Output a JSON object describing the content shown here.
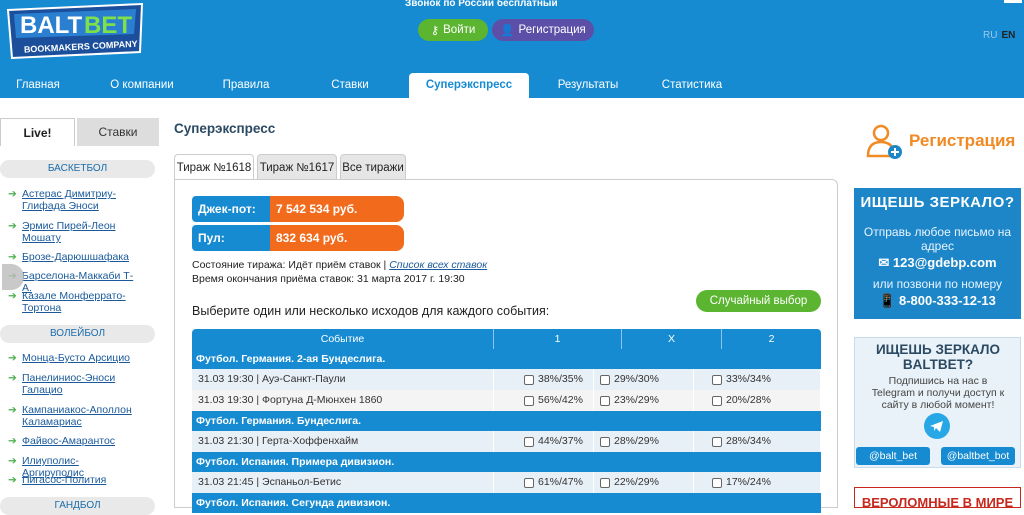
{
  "header": {
    "logo_text_1": "BALT",
    "logo_text_2": "BET",
    "logo_subtitle": "BOOKMAKERS COMPANY",
    "phone_text": "Звонок по России бесплатный",
    "login_label": "Войти",
    "register_label": "Регистрация",
    "lang_ru": "RU",
    "lang_en": "EN"
  },
  "nav": [
    "Главная",
    "О компании",
    "Правила",
    "Ставки",
    "Суперэкспресс",
    "Результаты",
    "Статистика"
  ],
  "sidebar": {
    "tab_live": "Live!",
    "tab_bets": "Ставки",
    "sections": [
      {
        "title": "БАСКЕТБОЛ",
        "events": [
          "Астерас Димитриу-Глифада Эноси",
          "Эрмис Пирей-Леон Мошату",
          "Брозе-Дарюшшафака",
          "Барселона-Маккаби Т-А.",
          "Казале Монферрато-Тортона"
        ]
      },
      {
        "title": "ВОЛЕЙБОЛ",
        "events": [
          "Монца-Бусто Арсицио",
          "Панелиниос-Эноси Галацио",
          "Кампаниакос-Аполлон Каламариас",
          "Файвос-Амарантос",
          "Илиуполис-Аргируполис",
          "Пигасос-Полития"
        ]
      },
      {
        "title": "ГАНДБОЛ",
        "events": []
      }
    ]
  },
  "main": {
    "title": "Суперэкспресс",
    "tabs": [
      "Тираж №1618",
      "Тираж №1617",
      "Все тиражи"
    ],
    "jackpot_label": "Джек-пот:",
    "jackpot_value": "7 542 534 руб.",
    "pool_label": "Пул:",
    "pool_value": "832 634 руб.",
    "status_text": "Состояние тиража: Идёт приём ставок |",
    "status_link": "Список всех ставок",
    "end_time": "Время окончания приёма ставок: 31 марта 2017 г. 19:30",
    "choose_text": "Выберите один или несколько исходов для каждого события:",
    "random_button": "Случайный выбор",
    "table": {
      "headers": [
        "Событие",
        "1",
        "X",
        "2"
      ],
      "groups": [
        {
          "title": "Футбол. Германия. 2-ая Бундеслига.",
          "rows": [
            {
              "event": "31.03 19:30 | Ауэ-Санкт-Паули",
              "p1": "38%/35%",
              "px": "29%/30%",
              "p2": "33%/34%"
            },
            {
              "event": "31.03 19:30 | Фортуна Д-Мюнхен 1860",
              "p1": "56%/42%",
              "px": "23%/29%",
              "p2": "20%/28%"
            }
          ]
        },
        {
          "title": "Футбол. Германия. Бундеслига.",
          "rows": [
            {
              "event": "31.03 21:30 | Герта-Хоффенхайм",
              "p1": "44%/37%",
              "px": "28%/29%",
              "p2": "28%/34%"
            }
          ]
        },
        {
          "title": "Футбол. Испания. Примера дивизион.",
          "rows": [
            {
              "event": "31.03 21:45 | Эспаньол-Бетис",
              "p1": "61%/47%",
              "px": "22%/29%",
              "p2": "17%/24%"
            }
          ]
        },
        {
          "title": "Футбол. Испания. Сегунда дивизион.",
          "rows": []
        }
      ]
    }
  },
  "right": {
    "register_text": "Регистрация",
    "banner1": {
      "title": "ИЩЕШЬ ЗЕРКАЛО?",
      "line1": "Отправь любое письмо на адрес",
      "email": "✉ 123@gdebp.com",
      "line2": "или позвони по номеру",
      "phone": "📱 8-800-333-12-13"
    },
    "banner2": {
      "title": "ИЩЕШЬ ЗЕРКАЛО BALTBET?",
      "text": "Подпишись на нас в Telegram и получи доступ к сайту в любой момент!",
      "btn1": "@balt_bet",
      "btn2": "@baltbet_bot"
    },
    "banner3": {
      "title": "ВЕРОЛОМНЫЕ В МИРЕ"
    }
  },
  "colors": {
    "primary": "#168bd2",
    "green": "#5cb531",
    "orange": "#f26b1d",
    "purple": "#5b4fa8"
  }
}
